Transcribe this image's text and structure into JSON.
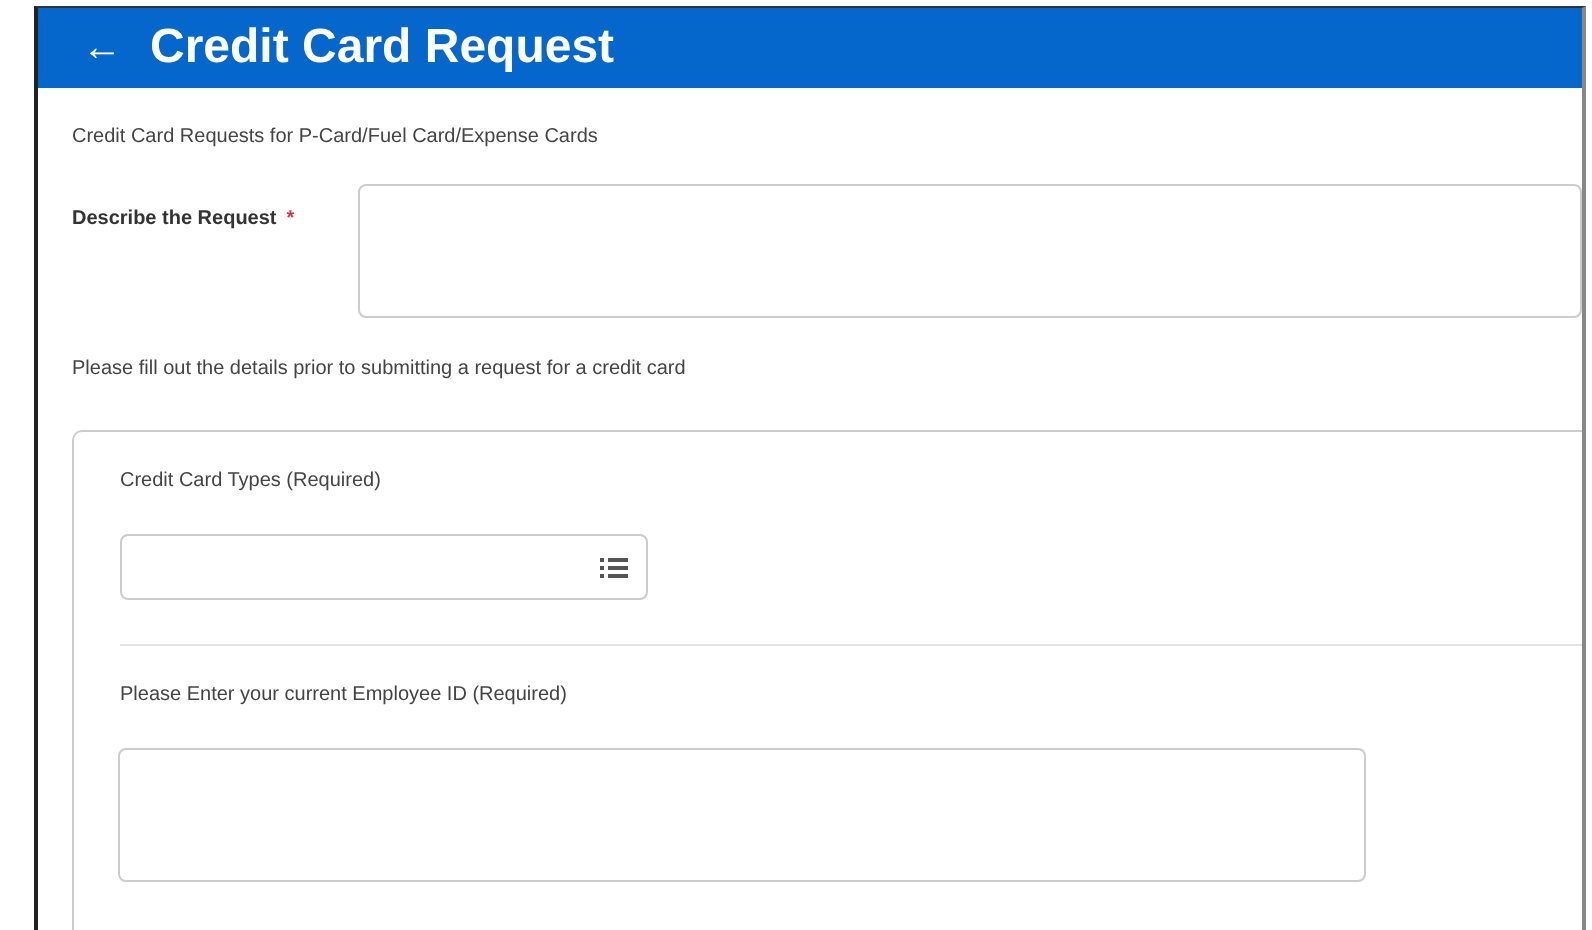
{
  "header": {
    "back": "←",
    "title": "Credit Card Request"
  },
  "intro": "Credit Card Requests for P-Card/Fuel Card/Expense Cards",
  "describe": {
    "label": "Describe the Request",
    "required": true,
    "required_mark": "*"
  },
  "instructions": "Please fill out the details prior to submitting a request for a credit card",
  "card": {
    "fields": [
      {
        "kind": "select",
        "label": "Credit Card Types (Required)"
      },
      {
        "kind": "text",
        "label": "Please Enter your current Employee ID (Required)"
      }
    ]
  }
}
